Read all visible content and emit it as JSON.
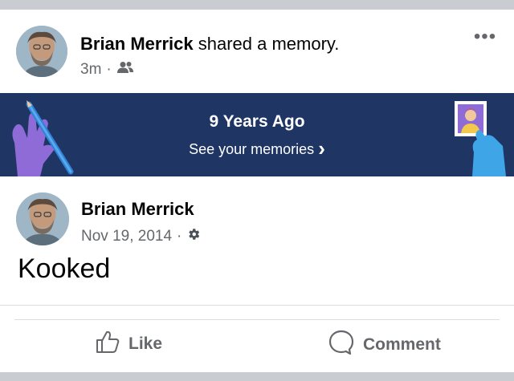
{
  "post": {
    "author": "Brian Merrick",
    "action": "shared a memory.",
    "time": "3m",
    "dot": "·",
    "audience_icon": "friends-icon",
    "more_icon": "more-options-icon",
    "more_glyph": "•••"
  },
  "memory_banner": {
    "title": "9 Years Ago",
    "link": "See your memories",
    "link_chevron": "›",
    "colors": {
      "background": "#1f3564",
      "left_hand": "#8e6bd6",
      "right_hand": "#3ea6e6"
    }
  },
  "shared_post": {
    "author": "Brian Merrick",
    "date": "Nov 19, 2014",
    "dot": "·",
    "privacy_icon": "gear-icon",
    "text": "Kooked"
  },
  "actions": {
    "like": {
      "label": "Like",
      "icon": "thumbs-up-icon"
    },
    "comment": {
      "label": "Comment",
      "icon": "comment-bubble-icon"
    }
  }
}
